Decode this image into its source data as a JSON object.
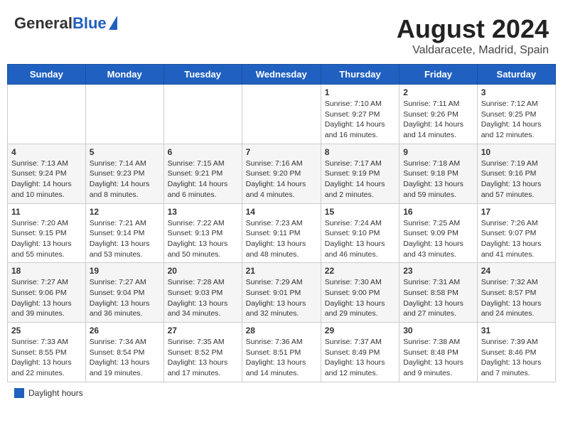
{
  "header": {
    "logo_general": "General",
    "logo_blue": "Blue",
    "month_year": "August 2024",
    "location": "Valdaracete, Madrid, Spain"
  },
  "days_of_week": [
    "Sunday",
    "Monday",
    "Tuesday",
    "Wednesday",
    "Thursday",
    "Friday",
    "Saturday"
  ],
  "weeks": [
    [
      {
        "day": "",
        "info": ""
      },
      {
        "day": "",
        "info": ""
      },
      {
        "day": "",
        "info": ""
      },
      {
        "day": "",
        "info": ""
      },
      {
        "day": "1",
        "info": "Sunrise: 7:10 AM\nSunset: 9:27 PM\nDaylight: 14 hours\nand 16 minutes."
      },
      {
        "day": "2",
        "info": "Sunrise: 7:11 AM\nSunset: 9:26 PM\nDaylight: 14 hours\nand 14 minutes."
      },
      {
        "day": "3",
        "info": "Sunrise: 7:12 AM\nSunset: 9:25 PM\nDaylight: 14 hours\nand 12 minutes."
      }
    ],
    [
      {
        "day": "4",
        "info": "Sunrise: 7:13 AM\nSunset: 9:24 PM\nDaylight: 14 hours\nand 10 minutes."
      },
      {
        "day": "5",
        "info": "Sunrise: 7:14 AM\nSunset: 9:23 PM\nDaylight: 14 hours\nand 8 minutes."
      },
      {
        "day": "6",
        "info": "Sunrise: 7:15 AM\nSunset: 9:21 PM\nDaylight: 14 hours\nand 6 minutes."
      },
      {
        "day": "7",
        "info": "Sunrise: 7:16 AM\nSunset: 9:20 PM\nDaylight: 14 hours\nand 4 minutes."
      },
      {
        "day": "8",
        "info": "Sunrise: 7:17 AM\nSunset: 9:19 PM\nDaylight: 14 hours\nand 2 minutes."
      },
      {
        "day": "9",
        "info": "Sunrise: 7:18 AM\nSunset: 9:18 PM\nDaylight: 13 hours\nand 59 minutes."
      },
      {
        "day": "10",
        "info": "Sunrise: 7:19 AM\nSunset: 9:16 PM\nDaylight: 13 hours\nand 57 minutes."
      }
    ],
    [
      {
        "day": "11",
        "info": "Sunrise: 7:20 AM\nSunset: 9:15 PM\nDaylight: 13 hours\nand 55 minutes."
      },
      {
        "day": "12",
        "info": "Sunrise: 7:21 AM\nSunset: 9:14 PM\nDaylight: 13 hours\nand 53 minutes."
      },
      {
        "day": "13",
        "info": "Sunrise: 7:22 AM\nSunset: 9:13 PM\nDaylight: 13 hours\nand 50 minutes."
      },
      {
        "day": "14",
        "info": "Sunrise: 7:23 AM\nSunset: 9:11 PM\nDaylight: 13 hours\nand 48 minutes."
      },
      {
        "day": "15",
        "info": "Sunrise: 7:24 AM\nSunset: 9:10 PM\nDaylight: 13 hours\nand 46 minutes."
      },
      {
        "day": "16",
        "info": "Sunrise: 7:25 AM\nSunset: 9:09 PM\nDaylight: 13 hours\nand 43 minutes."
      },
      {
        "day": "17",
        "info": "Sunrise: 7:26 AM\nSunset: 9:07 PM\nDaylight: 13 hours\nand 41 minutes."
      }
    ],
    [
      {
        "day": "18",
        "info": "Sunrise: 7:27 AM\nSunset: 9:06 PM\nDaylight: 13 hours\nand 39 minutes."
      },
      {
        "day": "19",
        "info": "Sunrise: 7:27 AM\nSunset: 9:04 PM\nDaylight: 13 hours\nand 36 minutes."
      },
      {
        "day": "20",
        "info": "Sunrise: 7:28 AM\nSunset: 9:03 PM\nDaylight: 13 hours\nand 34 minutes."
      },
      {
        "day": "21",
        "info": "Sunrise: 7:29 AM\nSunset: 9:01 PM\nDaylight: 13 hours\nand 32 minutes."
      },
      {
        "day": "22",
        "info": "Sunrise: 7:30 AM\nSunset: 9:00 PM\nDaylight: 13 hours\nand 29 minutes."
      },
      {
        "day": "23",
        "info": "Sunrise: 7:31 AM\nSunset: 8:58 PM\nDaylight: 13 hours\nand 27 minutes."
      },
      {
        "day": "24",
        "info": "Sunrise: 7:32 AM\nSunset: 8:57 PM\nDaylight: 13 hours\nand 24 minutes."
      }
    ],
    [
      {
        "day": "25",
        "info": "Sunrise: 7:33 AM\nSunset: 8:55 PM\nDaylight: 13 hours\nand 22 minutes."
      },
      {
        "day": "26",
        "info": "Sunrise: 7:34 AM\nSunset: 8:54 PM\nDaylight: 13 hours\nand 19 minutes."
      },
      {
        "day": "27",
        "info": "Sunrise: 7:35 AM\nSunset: 8:52 PM\nDaylight: 13 hours\nand 17 minutes."
      },
      {
        "day": "28",
        "info": "Sunrise: 7:36 AM\nSunset: 8:51 PM\nDaylight: 13 hours\nand 14 minutes."
      },
      {
        "day": "29",
        "info": "Sunrise: 7:37 AM\nSunset: 8:49 PM\nDaylight: 13 hours\nand 12 minutes."
      },
      {
        "day": "30",
        "info": "Sunrise: 7:38 AM\nSunset: 8:48 PM\nDaylight: 13 hours\nand 9 minutes."
      },
      {
        "day": "31",
        "info": "Sunrise: 7:39 AM\nSunset: 8:46 PM\nDaylight: 13 hours\nand 7 minutes."
      }
    ]
  ],
  "footer": {
    "legend_label": "Daylight hours"
  }
}
